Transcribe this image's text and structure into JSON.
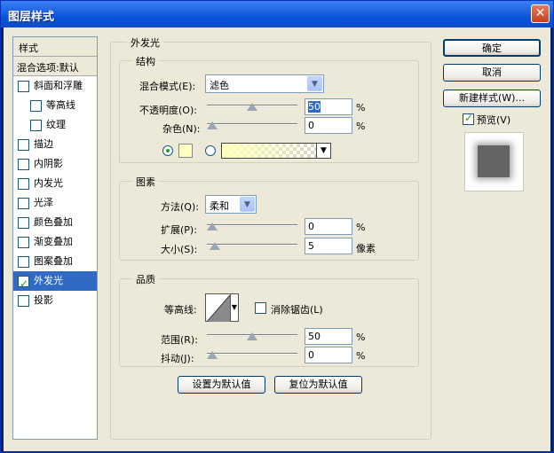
{
  "title": "图层样式",
  "nav": {
    "header": "样式",
    "blend_options": "混合选项:默认",
    "items": [
      {
        "label": "斜面和浮雕",
        "checked": false,
        "indent": false
      },
      {
        "label": "等高线",
        "checked": false,
        "indent": true
      },
      {
        "label": "纹理",
        "checked": false,
        "indent": true
      },
      {
        "label": "描边",
        "checked": false,
        "indent": false
      },
      {
        "label": "内阴影",
        "checked": false,
        "indent": false
      },
      {
        "label": "内发光",
        "checked": false,
        "indent": false
      },
      {
        "label": "光泽",
        "checked": false,
        "indent": false
      },
      {
        "label": "颜色叠加",
        "checked": false,
        "indent": false
      },
      {
        "label": "渐变叠加",
        "checked": false,
        "indent": false
      },
      {
        "label": "图案叠加",
        "checked": false,
        "indent": false
      },
      {
        "label": "外发光",
        "checked": true,
        "indent": false,
        "selected": true
      },
      {
        "label": "投影",
        "checked": false,
        "indent": false
      }
    ]
  },
  "panel": {
    "title": "外发光",
    "structure": {
      "title": "结构",
      "blend_mode_label": "混合模式(E):",
      "blend_mode_value": "滤色",
      "opacity_label": "不透明度(O):",
      "opacity_value": "50",
      "opacity_fraction": 0.5,
      "noise_label": "杂色(N):",
      "noise_value": "0",
      "noise_fraction": 0.0,
      "percent": "%",
      "color": "#ffffbe"
    },
    "elements": {
      "title": "图素",
      "technique_label": "方法(Q):",
      "technique_value": "柔和",
      "spread_label": "扩展(P):",
      "spread_value": "0",
      "spread_fraction": 0.0,
      "size_label": "大小(S):",
      "size_value": "5",
      "size_fraction": 0.03,
      "size_unit": "像素",
      "percent": "%"
    },
    "quality": {
      "title": "品质",
      "contour_label": "等高线:",
      "anti_alias_label": "消除锯齿(L)",
      "anti_alias_checked": false,
      "range_label": "范围(R):",
      "range_value": "50",
      "range_fraction": 0.5,
      "jitter_label": "抖动(J):",
      "jitter_value": "0",
      "jitter_fraction": 0.0,
      "percent": "%"
    },
    "set_default": "设置为默认值",
    "reset_default": "复位为默认值"
  },
  "buttons": {
    "ok": "确定",
    "cancel": "取消",
    "new_style": "新建样式(W)...",
    "preview_label": "预览(V)",
    "preview_checked": true
  }
}
